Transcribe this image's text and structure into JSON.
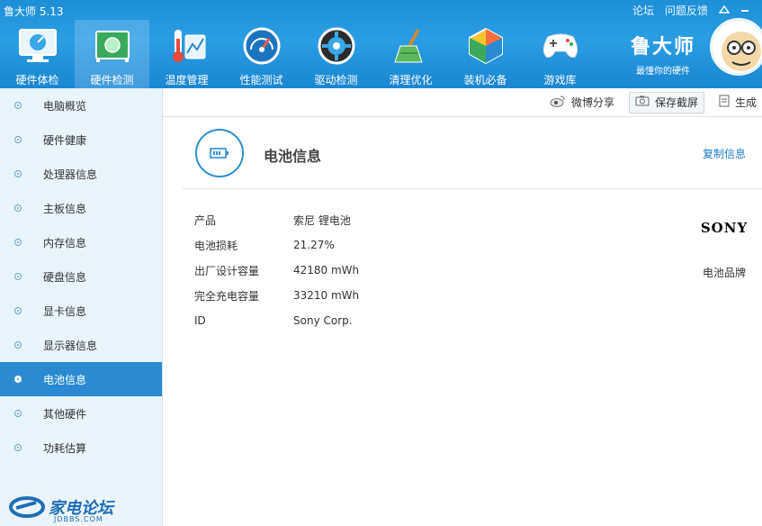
{
  "app": {
    "title": "鲁大师 5.13"
  },
  "top_links": {
    "forum": "论坛",
    "feedback": "问题反馈"
  },
  "toolbar": [
    {
      "label": "硬件体检",
      "icon": "monitor-icon"
    },
    {
      "label": "硬件检测",
      "icon": "circuit-board-icon"
    },
    {
      "label": "温度管理",
      "icon": "thermometer-icon"
    },
    {
      "label": "性能测试",
      "icon": "speedometer-icon"
    },
    {
      "label": "驱动检测",
      "icon": "driver-gear-icon"
    },
    {
      "label": "清理优化",
      "icon": "broom-icon"
    },
    {
      "label": "装机必备",
      "icon": "cube-icon"
    },
    {
      "label": "游戏库",
      "icon": "gamepad-icon"
    }
  ],
  "brand": {
    "name": "鲁大师",
    "slogan": "最懂你的硬件"
  },
  "sidebar": {
    "items": [
      {
        "label": "电脑概览"
      },
      {
        "label": "硬件健康"
      },
      {
        "label": "处理器信息"
      },
      {
        "label": "主板信息"
      },
      {
        "label": "内存信息"
      },
      {
        "label": "硬盘信息"
      },
      {
        "label": "显卡信息"
      },
      {
        "label": "显示器信息"
      },
      {
        "label": "电池信息"
      },
      {
        "label": "其他硬件"
      },
      {
        "label": "功耗估算"
      }
    ],
    "active_index": 8
  },
  "forum_logo": {
    "text": "家电论坛",
    "sub": "JDBBS.COM"
  },
  "actions": {
    "weibo": "微博分享",
    "screenshot": "保存截屏",
    "generate": "生成"
  },
  "section": {
    "title": "电池信息",
    "copy": "复制信息"
  },
  "battery": {
    "rows": [
      {
        "key": "产品",
        "value": "索尼 锂电池"
      },
      {
        "key": "电池损耗",
        "value": "21.27%"
      },
      {
        "key": "出厂设计容量",
        "value": "42180 mWh"
      },
      {
        "key": "完全充电容量",
        "value": "33210 mWh"
      },
      {
        "key": "ID",
        "value": "Sony Corp."
      }
    ],
    "brand_logo": "SONY",
    "brand_label": "电池品牌"
  },
  "colors": {
    "accent": "#2a8bd2",
    "topbar": "#1d8fd8",
    "link": "#1f7cc8"
  }
}
